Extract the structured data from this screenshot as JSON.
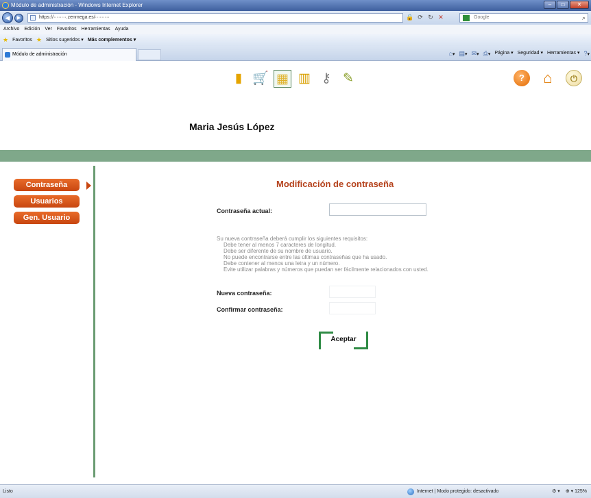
{
  "window": {
    "title": "Módulo de administración - Windows Internet Explorer",
    "controls": [
      "–",
      "▭",
      "✕"
    ]
  },
  "address": {
    "url": "https://········.zenmega.es/·········",
    "search_engine": "Google",
    "back_label": "◀",
    "forward_label": "▶",
    "tools": [
      "🔒",
      "⟳",
      "↻",
      "✕"
    ]
  },
  "menu": [
    "Archivo",
    "Edición",
    "Ver",
    "Favoritos",
    "Herramientas",
    "Ayuda"
  ],
  "favorites_bar": {
    "favorites_label": "Favoritos",
    "suggested_label": "Sitios sugeridos ▾",
    "more_label": "Más complementos ▾"
  },
  "tab": {
    "title": "Módulo de administración"
  },
  "command_bar": {
    "items": [
      {
        "icon": "⌂",
        "label": "▾"
      },
      {
        "icon": "▤",
        "label": "▾"
      },
      {
        "icon": "✉",
        "label": "▾"
      },
      {
        "icon": "⎙",
        "label": "▾"
      },
      {
        "icon": "",
        "label": "Página ▾"
      },
      {
        "icon": "",
        "label": "Seguridad ▾"
      },
      {
        "icon": "",
        "label": "Herramientas ▾"
      },
      {
        "icon": "?",
        "label": "▾"
      }
    ]
  },
  "toolbar_icons": [
    "▮",
    "🛒",
    "▦",
    "▥",
    "⚷",
    "✎"
  ],
  "right_icons": {
    "help": "?",
    "home": "⌂",
    "power": "⏻"
  },
  "user": {
    "name": "Maria Jesús López"
  },
  "sidebar": {
    "items": [
      {
        "label": "Contraseña"
      },
      {
        "label": "Usuarios"
      },
      {
        "label": "Gen. Usuario"
      }
    ]
  },
  "form": {
    "title": "Modificación de contraseña",
    "current_label": "Contraseña actual:",
    "requirements_intro": "Su nueva contraseña deberá cumplir los siguientes requisitos:",
    "requirements": [
      "Debe tener al menos 7 caracteres de longitud.",
      "Debe ser diferente de su nombre de usuario.",
      "No puede encontrarse entre las últimas contraseñas que ha usado.",
      "Debe contener al menos una letra y un número.",
      "Evite utilizar palabras y números que puedan ser fácilmente relacionados con usted."
    ],
    "new_label": "Nueva contraseña:",
    "confirm_label": "Confirmar contraseña:",
    "submit_label": "Aceptar"
  },
  "status": {
    "left": "Listo",
    "zone": "Internet | Modo protegido: desactivado",
    "zoom": "125%",
    "zoom_icon": "⊕ ▾",
    "settings_icon": "⚙ ▾"
  },
  "colors": {
    "accent_orange": "#c84610",
    "title_red": "#b5421c",
    "green_band": "#7fa88a",
    "green_line": "#6a9c72"
  }
}
